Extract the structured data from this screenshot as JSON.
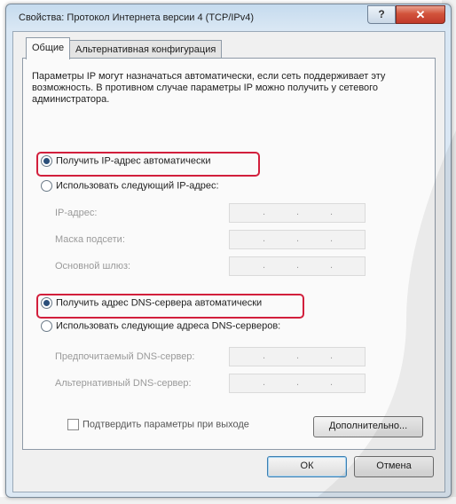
{
  "window": {
    "title": "Свойства: Протокол Интернета версии 4 (TCP/IPv4)",
    "help_label": "?",
    "close_label": "✕"
  },
  "tabs": [
    {
      "label": "Общие"
    },
    {
      "label": "Альтернативная конфигурация"
    }
  ],
  "description": "Параметры IP могут назначаться автоматически, если сеть поддерживает эту возможность. В противном случае параметры IP можно получить у сетевого администратора.",
  "ip_section": {
    "auto_radio": "Получить IP-адрес автоматически",
    "manual_radio": "Использовать следующий IP-адрес:",
    "fields": [
      {
        "label": "IP-адрес:"
      },
      {
        "label": "Маска подсети:"
      },
      {
        "label": "Основной шлюз:"
      }
    ]
  },
  "dns_section": {
    "auto_radio": "Получить адрес DNS-сервера автоматически",
    "manual_radio": "Использовать следующие адреса DNS-серверов:",
    "fields": [
      {
        "label": "Предпочитаемый DNS-сервер:"
      },
      {
        "label": "Альтернативный DNS-сервер:"
      }
    ]
  },
  "validate_checkbox": "Подтвердить параметры при выходе",
  "buttons": {
    "advanced": "Дополнительно...",
    "ok": "ОК",
    "cancel": "Отмена"
  },
  "colors": {
    "highlight": "#d21f3c",
    "window_frame": "#c5dbee",
    "close_button": "#c0392b"
  }
}
